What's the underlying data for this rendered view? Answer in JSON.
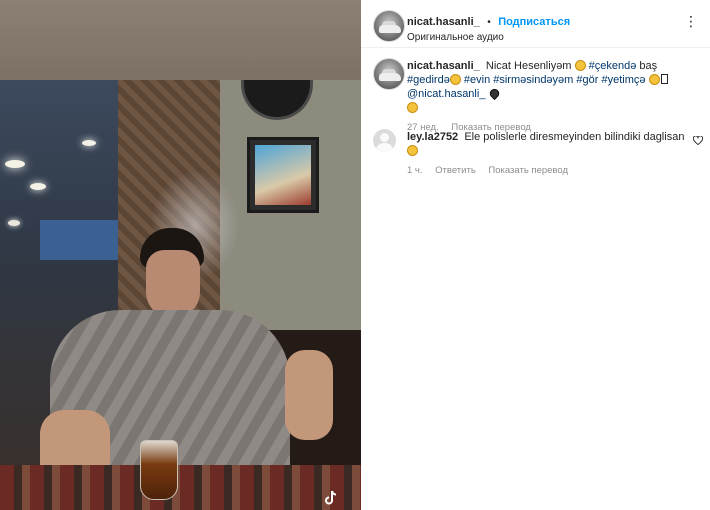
{
  "post": {
    "author": "nicat.hasanli_",
    "separator": "•",
    "follow_label": "Подписаться",
    "audio_label": "Оригинальное аудио",
    "more_icon": "more-horizontal-icon",
    "more_glyph": "⋮"
  },
  "caption": {
    "author": "nicat.hasanli_",
    "text_1": "Nicat Hesenliyəm",
    "tag_1": "#çekendə",
    "text_2": "baş",
    "tag_2": "#gedirdə",
    "tag_3": "#evin",
    "tag_4": "#sirməsindəyəm",
    "tag_5": "#gör",
    "tag_6": "#yetimçə",
    "mention": "@nicat.hasanli_",
    "time": "27 нед.",
    "translate_label": "Показать перевод"
  },
  "comments": [
    {
      "username": "ley.la2752",
      "text": "Ele polislerle diresmeyinden bilindiki daglisan",
      "time": "1 ч.",
      "reply_label": "Ответить",
      "translate_label": "Показать перевод"
    }
  ],
  "media": {
    "logo_icon": "tiktok-icon"
  }
}
